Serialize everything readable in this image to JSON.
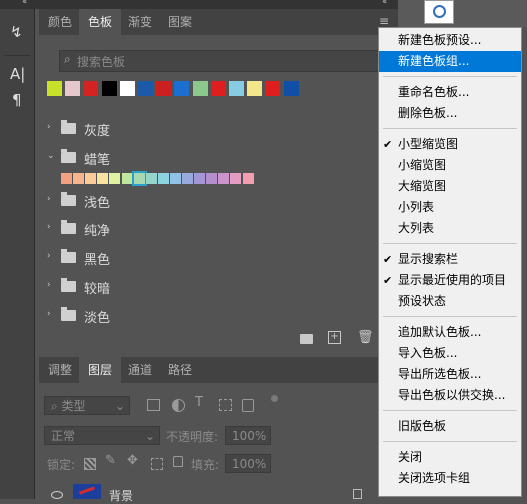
{
  "tabs": [
    "颜色",
    "色板",
    "渐变",
    "图案"
  ],
  "search": {
    "placeholder": "搜索色板"
  },
  "recent_swatches": [
    "#c7e02a",
    "#e6c7cc",
    "#d42323",
    "#000000",
    "#ffffff",
    "#1a5aa8",
    "#cc1f1f",
    "#1c6ed1",
    "#8cc88c",
    "#df1f1f",
    "#86cde3",
    "#f2e58a",
    "#df1f1f",
    "#0f4fa8"
  ],
  "groups": [
    {
      "name": "灰度",
      "expanded": false
    },
    {
      "name": "蜡笔",
      "expanded": true
    },
    {
      "name": "浅色",
      "expanded": false
    },
    {
      "name": "纯净",
      "expanded": false
    },
    {
      "name": "黑色",
      "expanded": false
    },
    {
      "name": "较暗",
      "expanded": false
    },
    {
      "name": "淡色",
      "expanded": false
    }
  ],
  "crayon_swatches": [
    "#f2a283",
    "#f6b58e",
    "#f9cc99",
    "#f8e4a0",
    "#dff2a2",
    "#c0e59c",
    "#a7dab4",
    "#96d5c9",
    "#8ed3e0",
    "#92c1e6",
    "#98a9de",
    "#a397d5",
    "#b38fcc",
    "#cb95cc",
    "#e59cc2",
    "#f19fae"
  ],
  "layers_tabs": [
    "调整",
    "图层",
    "通道",
    "路径"
  ],
  "layers": {
    "filter_label": "类型",
    "blend_mode": "正常",
    "opacity_label": "不透明度:",
    "opacity_value": "100%",
    "lock_label": "锁定:",
    "fill_label": "填充:",
    "fill_value": "100%",
    "layer_name": "背景"
  },
  "menu": {
    "items": [
      {
        "label": "新建色板预设...",
        "checked": false,
        "highlighted": false
      },
      {
        "label": "新建色板组...",
        "checked": false,
        "highlighted": true
      },
      {
        "sep": true
      },
      {
        "label": "重命名色板...",
        "checked": false
      },
      {
        "label": "删除色板...",
        "checked": false
      },
      {
        "sep": true
      },
      {
        "label": "小型缩览图",
        "checked": true
      },
      {
        "label": "小缩览图",
        "checked": false
      },
      {
        "label": "大缩览图",
        "checked": false
      },
      {
        "label": "小列表",
        "checked": false
      },
      {
        "label": "大列表",
        "checked": false
      },
      {
        "sep": true
      },
      {
        "label": "显示搜索栏",
        "checked": true
      },
      {
        "label": "显示最近使用的项目",
        "checked": true
      },
      {
        "label": "预设状态",
        "checked": false
      },
      {
        "sep": true
      },
      {
        "label": "追加默认色板...",
        "checked": false
      },
      {
        "label": "导入色板...",
        "checked": false
      },
      {
        "label": "导出所选色板...",
        "checked": false
      },
      {
        "label": "导出色板以供交换...",
        "checked": false
      },
      {
        "sep": true
      },
      {
        "label": "旧版色板",
        "checked": false
      },
      {
        "sep": true
      },
      {
        "label": "关闭",
        "checked": false
      },
      {
        "label": "关闭选项卡组",
        "checked": false
      }
    ]
  }
}
